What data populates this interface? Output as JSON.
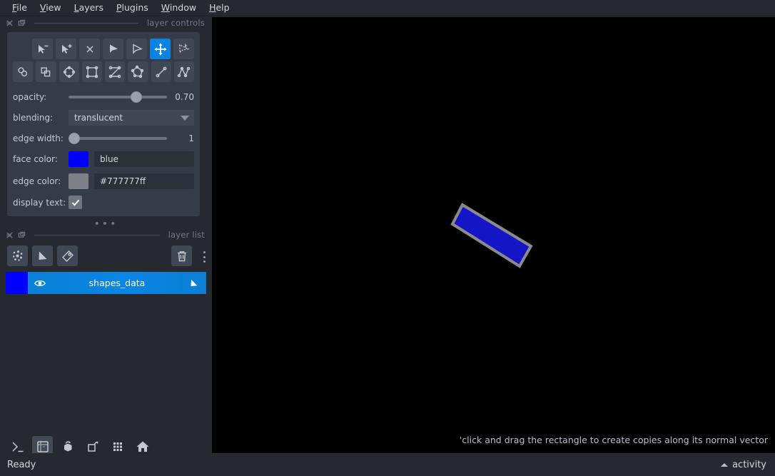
{
  "menu": {
    "items": [
      {
        "label": "File",
        "mnemonic": "F"
      },
      {
        "label": "View",
        "mnemonic": "V"
      },
      {
        "label": "Layers",
        "mnemonic": "L"
      },
      {
        "label": "Plugins",
        "mnemonic": "P"
      },
      {
        "label": "Window",
        "mnemonic": "W"
      },
      {
        "label": "Help",
        "mnemonic": "H"
      }
    ]
  },
  "layer_controls": {
    "title": "layer controls",
    "tools_row1": [
      {
        "name": "select-vertex-remove",
        "tooltip": "remove vertex",
        "active": false
      },
      {
        "name": "select-vertex-add",
        "tooltip": "add vertex",
        "active": false
      },
      {
        "name": "delete-shape",
        "tooltip": "delete selected shape",
        "active": false
      },
      {
        "name": "direct-select",
        "tooltip": "select vertices",
        "active": false
      },
      {
        "name": "select-shapes",
        "tooltip": "select shapes",
        "active": false
      },
      {
        "name": "pan-zoom",
        "tooltip": "pan/zoom",
        "active": true
      },
      {
        "name": "transform",
        "tooltip": "transform",
        "active": false
      }
    ],
    "tools_row2": [
      {
        "name": "select-ellipse",
        "tooltip": "select ellipse",
        "active": false
      },
      {
        "name": "select-rectangle",
        "tooltip": "select rectangle",
        "active": false
      },
      {
        "name": "add-ellipse",
        "tooltip": "add ellipses",
        "active": false
      },
      {
        "name": "add-rectangle",
        "tooltip": "add rectangles",
        "active": false
      },
      {
        "name": "add-polygon-lasso",
        "tooltip": "add polygon lasso",
        "active": false
      },
      {
        "name": "add-polygon",
        "tooltip": "add polygons",
        "active": false
      },
      {
        "name": "add-line",
        "tooltip": "add line",
        "active": false
      },
      {
        "name": "add-path",
        "tooltip": "add path",
        "active": false
      }
    ],
    "opacity": {
      "label": "opacity:",
      "value": "0.70",
      "percent": 70
    },
    "blending": {
      "label": "blending:",
      "value": "translucent"
    },
    "edge_width": {
      "label": "edge width:",
      "value": "1",
      "percent": 2
    },
    "face_color": {
      "label": "face color:",
      "value": "blue",
      "hex": "#0000ff"
    },
    "edge_color": {
      "label": "edge color:",
      "value": "#777777ff",
      "hex": "#777777"
    },
    "display_text": {
      "label": "display text:",
      "checked": true
    }
  },
  "layer_list": {
    "title": "layer list",
    "buttons": [
      {
        "name": "new-points-layer",
        "tooltip": "New points layer"
      },
      {
        "name": "new-shapes-layer",
        "tooltip": "New shapes layer"
      },
      {
        "name": "new-labels-layer",
        "tooltip": "New labels layer"
      },
      {
        "name": "delete-layer",
        "tooltip": "Delete selected layers"
      }
    ],
    "layers": [
      {
        "name": "shapes_data",
        "thumb_color": "#0000ff",
        "visible": true,
        "selected": true,
        "type": "shapes"
      }
    ]
  },
  "bottom_toolbar": [
    {
      "name": "console-button",
      "tooltip": "Open IPython terminal",
      "pressed": false
    },
    {
      "name": "ndisplay-button",
      "tooltip": "Toggle 2D/3D view",
      "pressed": true
    },
    {
      "name": "roll-dims-button",
      "tooltip": "Roll dimensions order",
      "pressed": false
    },
    {
      "name": "transpose-dims-button",
      "tooltip": "Transpose displayed dimensions",
      "pressed": false
    },
    {
      "name": "grid-view-button",
      "tooltip": "Toggle grid view",
      "pressed": false
    },
    {
      "name": "home-button",
      "tooltip": "Reset view",
      "pressed": false
    }
  ],
  "canvas": {
    "background": "#000000",
    "hint": "'click and drag the rectangle to create copies along its normal vector",
    "shape": {
      "type": "rectangle",
      "face_color": "#1515c8",
      "edge_color": "#8a8a8a",
      "points": "[[648,287],[744,345],[728,373],[634,314]]"
    }
  },
  "statusbar": {
    "status": "Ready",
    "activity_label": "activity"
  }
}
